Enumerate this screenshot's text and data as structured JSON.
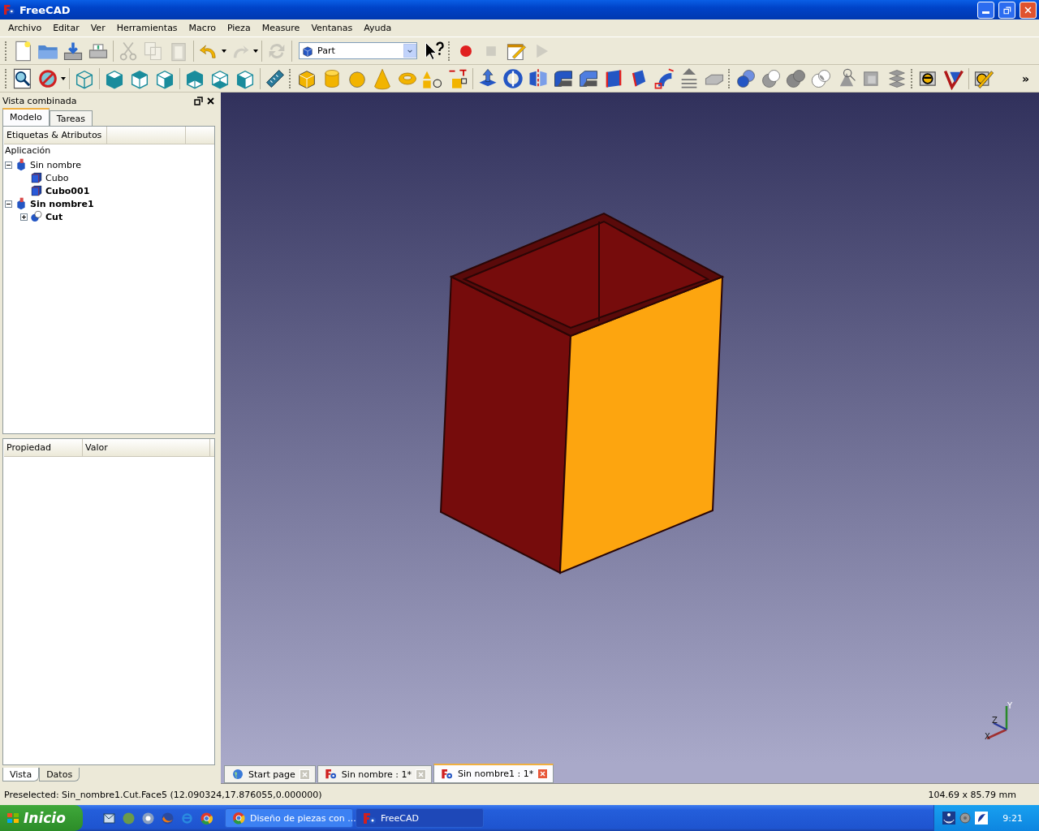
{
  "window": {
    "title": "FreeCAD"
  },
  "menu": [
    "Archivo",
    "Editar",
    "Ver",
    "Herramientas",
    "Macro",
    "Pieza",
    "Measure",
    "Ventanas",
    "Ayuda"
  ],
  "toolbars": [
    [
      [
        {
          "kind": "icon",
          "disabled": false
        },
        {
          "kind": "icon",
          "disabled": false
        },
        {
          "kind": "icon",
          "disabled": false
        },
        {
          "kind": "icon",
          "disabled": false
        }
      ],
      [
        {
          "kind": "icon",
          "disabled": true
        },
        {
          "kind": "icon",
          "disabled": true
        },
        {
          "kind": "icon",
          "disabled": true
        }
      ],
      [
        {
          "kind": "icon",
          "disabled": false
        },
        {
          "kind": "icon",
          "disabled": true
        }
      ],
      [
        {
          "kind": "icon",
          "disabled": true
        }
      ],
      [
        {
          "kind": "combo",
          "value": "Part"
        },
        {
          "kind": "icon",
          "disabled": false
        }
      ],
      [
        {
          "kind": "icon",
          "disabled": false
        },
        {
          "kind": "icon",
          "disabled": true
        },
        {
          "kind": "icon",
          "disabled": false
        },
        {
          "kind": "icon",
          "disabled": true
        }
      ]
    ],
    [
      [
        {
          "kind": "icon",
          "disabled": false
        },
        {
          "kind": "icon",
          "disabled": false
        }
      ],
      [
        {
          "kind": "icon",
          "disabled": false
        }
      ],
      [
        {
          "kind": "icon",
          "disabled": false
        },
        {
          "kind": "icon",
          "disabled": false
        },
        {
          "kind": "icon",
          "disabled": false
        }
      ],
      [
        {
          "kind": "icon",
          "disabled": false
        },
        {
          "kind": "icon",
          "disabled": false
        },
        {
          "kind": "icon",
          "disabled": false
        }
      ],
      [
        {
          "kind": "icon",
          "disabled": false
        }
      ],
      [
        {
          "kind": "icon",
          "disabled": false
        },
        {
          "kind": "icon",
          "disabled": false
        },
        {
          "kind": "icon",
          "disabled": false
        },
        {
          "kind": "icon",
          "disabled": false
        },
        {
          "kind": "icon",
          "disabled": false
        },
        {
          "kind": "icon",
          "disabled": false
        },
        {
          "kind": "icon",
          "disabled": false
        }
      ],
      [
        {
          "kind": "icon",
          "disabled": false
        },
        {
          "kind": "icon",
          "disabled": false
        },
        {
          "kind": "icon",
          "disabled": false
        },
        {
          "kind": "icon",
          "disabled": false
        },
        {
          "kind": "icon",
          "disabled": false
        },
        {
          "kind": "icon",
          "disabled": false
        },
        {
          "kind": "icon",
          "disabled": false
        },
        {
          "kind": "icon",
          "disabled": false
        },
        {
          "kind": "icon",
          "disabled": false
        },
        {
          "kind": "icon",
          "disabled": false
        }
      ],
      [
        {
          "kind": "icon",
          "disabled": false
        },
        {
          "kind": "icon",
          "disabled": false
        },
        {
          "kind": "icon",
          "disabled": false
        },
        {
          "kind": "icon",
          "disabled": false
        },
        {
          "kind": "icon",
          "disabled": false
        },
        {
          "kind": "icon",
          "disabled": false
        },
        {
          "kind": "icon",
          "disabled": false
        }
      ],
      [
        {
          "kind": "icon",
          "disabled": false
        },
        {
          "kind": "icon",
          "disabled": false
        }
      ],
      [
        {
          "kind": "icon",
          "disabled": false
        }
      ],
      [
        {
          "kind": "overflow",
          "label": "»"
        }
      ]
    ]
  ],
  "combo_view": {
    "title": "Vista combinada",
    "tabs": [
      {
        "label": "Modelo",
        "selected": true
      },
      {
        "label": "Tareas",
        "selected": false
      }
    ],
    "tree": {
      "column": "Etiquetas & Atributos",
      "root": "Aplicación",
      "items": [
        {
          "label": "Sin nombre",
          "kind": "document",
          "bold": false,
          "expanded": true,
          "children": [
            {
              "label": "Cubo",
              "kind": "cube",
              "bold": false
            },
            {
              "label": "Cubo001",
              "kind": "cube",
              "bold": true
            }
          ]
        },
        {
          "label": "Sin nombre1",
          "kind": "document",
          "bold": true,
          "expanded": true,
          "children": [
            {
              "label": "Cut",
              "kind": "cut",
              "bold": true,
              "expanded": false
            }
          ]
        }
      ]
    },
    "properties": {
      "columns": [
        "Propiedad",
        "Valor"
      ]
    },
    "bottom_tabs": [
      {
        "label": "Vista",
        "selected": true
      },
      {
        "label": "Datos",
        "selected": false
      }
    ]
  },
  "view": {
    "axis_labels": [
      "X",
      "Y",
      "Z"
    ]
  },
  "document_tabs": [
    {
      "label": "Start page",
      "kind": "web",
      "selected": false
    },
    {
      "label": "Sin nombre : 1*",
      "kind": "document",
      "selected": false
    },
    {
      "label": "Sin nombre1 : 1*",
      "kind": "document",
      "selected": true
    }
  ],
  "status_bar": {
    "message": "Preselected: Sin_nombre1.Cut.Face5 (12.090324,17.876055,0.000000)",
    "dimensions": "104.69 x 85.79 mm"
  },
  "taskbar": {
    "start": "Inicio",
    "tasks": [
      {
        "label": "Diseño de piezas con ...",
        "kind": "browser",
        "selected": false
      },
      {
        "label": "FreeCAD",
        "kind": "freecad",
        "selected": true
      }
    ],
    "clock": "9:21"
  }
}
